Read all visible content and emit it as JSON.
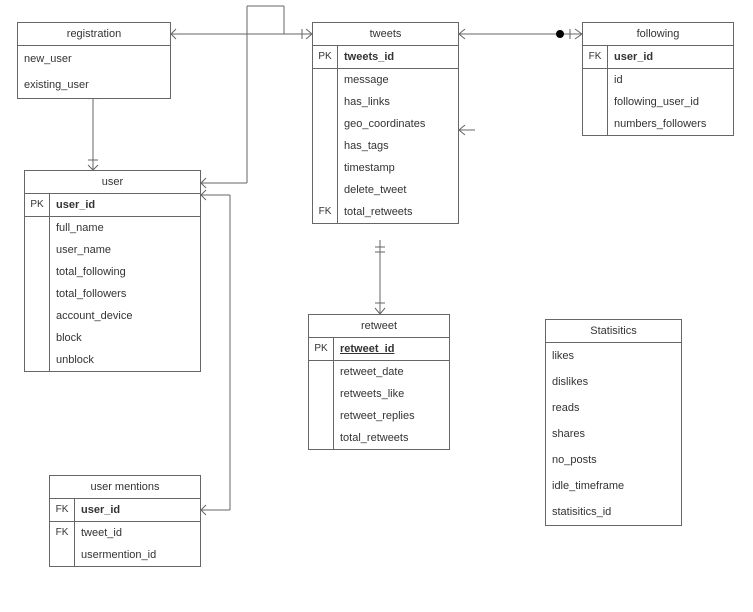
{
  "chart_data": {
    "type": "table",
    "diagram_kind": "entity-relationship",
    "entities": [
      {
        "name": "registration",
        "primary_key": null,
        "foreign_keys": [],
        "attributes": [
          "new_user",
          "existing_user"
        ]
      },
      {
        "name": "user",
        "primary_key": "user_id",
        "foreign_keys": [],
        "attributes": [
          "full_name",
          "user_name",
          "total_following",
          "total_followers",
          "account_device",
          "block",
          "unblock"
        ]
      },
      {
        "name": "user mentions",
        "primary_key": null,
        "foreign_keys": [
          "user_id",
          "tweet_id"
        ],
        "attributes": [
          "usermention_id"
        ]
      },
      {
        "name": "tweets",
        "primary_key": "tweets_id",
        "foreign_keys": [
          "total_retweets"
        ],
        "attributes": [
          "message",
          "has_links",
          "geo_coordinates",
          "has_tags",
          "timestamp",
          "delete_tweet"
        ]
      },
      {
        "name": "retweet",
        "primary_key": "retweet_id",
        "foreign_keys": [],
        "attributes": [
          "retweet_date",
          "retweets_like",
          "retweet_replies",
          "total_retweets"
        ]
      },
      {
        "name": "following",
        "primary_key": null,
        "foreign_keys": [
          "user_id"
        ],
        "attributes": [
          "id",
          "following_user_id",
          "numbers_followers"
        ]
      },
      {
        "name": "Statisitics",
        "primary_key": null,
        "foreign_keys": [],
        "attributes": [
          "likes",
          "dislikes",
          "reads",
          "shares",
          "no_posts",
          "idle_timeframe",
          "statisitics_id"
        ]
      }
    ],
    "relationships": [
      {
        "from": "registration",
        "to": "user"
      },
      {
        "from": "registration",
        "to": "tweets"
      },
      {
        "from": "user",
        "to": "tweets"
      },
      {
        "from": "user",
        "to": "user mentions"
      },
      {
        "from": "tweets",
        "to": "following"
      },
      {
        "from": "tweets",
        "to": "retweet"
      }
    ]
  },
  "entities": {
    "registration": {
      "title": "registration",
      "rows": [
        {
          "key": "",
          "name": "new_user"
        },
        {
          "key": "",
          "name": "existing_user"
        }
      ]
    },
    "user": {
      "title": "user",
      "pk": {
        "key": "PK",
        "name": "user_id"
      },
      "rows": [
        {
          "key": "",
          "name": "full_name"
        },
        {
          "key": "",
          "name": "user_name"
        },
        {
          "key": "",
          "name": "total_following"
        },
        {
          "key": "",
          "name": "total_followers"
        },
        {
          "key": "",
          "name": "account_device"
        },
        {
          "key": "",
          "name": "block"
        },
        {
          "key": "",
          "name": "unblock"
        }
      ]
    },
    "usermentions": {
      "title": "user mentions",
      "rows": [
        {
          "key": "FK",
          "name": "user_id",
          "bold": true
        },
        {
          "key": "FK",
          "name": "tweet_id"
        },
        {
          "key": "",
          "name": "usermention_id"
        }
      ]
    },
    "tweets": {
      "title": "tweets",
      "pk": {
        "key": "PK",
        "name": "tweets_id"
      },
      "rows": [
        {
          "key": "",
          "name": "message"
        },
        {
          "key": "",
          "name": "has_links"
        },
        {
          "key": "",
          "name": "geo_coordinates"
        },
        {
          "key": "",
          "name": "has_tags"
        },
        {
          "key": "",
          "name": "timestamp"
        },
        {
          "key": "",
          "name": "delete_tweet"
        },
        {
          "key": "FK",
          "name": "total_retweets"
        }
      ]
    },
    "retweet": {
      "title": "retweet",
      "pk": {
        "key": "PK",
        "name": "retweet_id",
        "underline": true
      },
      "rows": [
        {
          "key": "",
          "name": "retweet_date"
        },
        {
          "key": "",
          "name": "retweets_like"
        },
        {
          "key": "",
          "name": "retweet_replies"
        },
        {
          "key": "",
          "name": "total_retweets"
        }
      ]
    },
    "following": {
      "title": "following",
      "rows": [
        {
          "key": "FK",
          "name": "user_id",
          "bold": true
        },
        {
          "key": "",
          "name": "id"
        },
        {
          "key": "",
          "name": "following_user_id"
        },
        {
          "key": "",
          "name": "numbers_followers"
        }
      ]
    },
    "statistics": {
      "title": "Statisitics",
      "rows": [
        {
          "name": "likes"
        },
        {
          "name": "dislikes"
        },
        {
          "name": "reads"
        },
        {
          "name": "shares"
        },
        {
          "name": "no_posts"
        },
        {
          "name": "idle_timeframe"
        },
        {
          "name": "statisitics_id"
        }
      ]
    }
  }
}
